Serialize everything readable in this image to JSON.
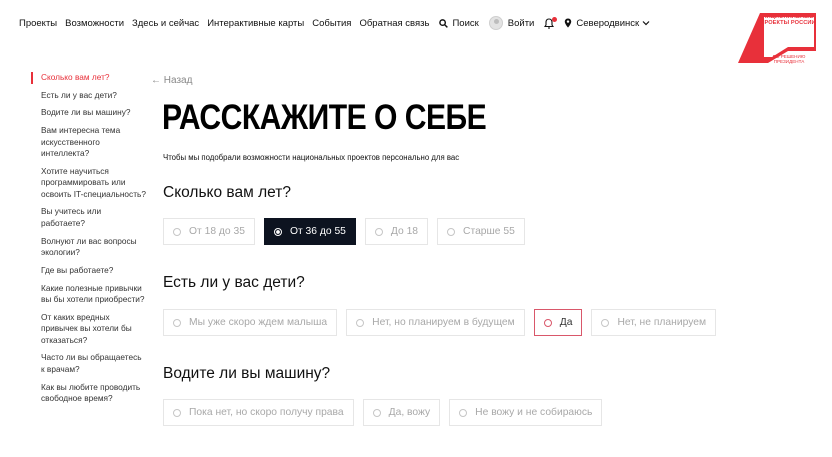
{
  "header": {
    "nav": [
      "Проекты",
      "Возможности",
      "Здесь и сейчас",
      "Интерактивные карты",
      "События",
      "Обратная связь"
    ],
    "search_label": "Поиск",
    "login_label": "Войти",
    "city": "Северодвинск",
    "logo_text": "НАЦИОНАЛЬНЫЕ ПРОЕКТЫ РОССИИ",
    "logo_subtext": "ПО РЕШЕНИЮ ПРЕЗИДЕНТА",
    "colors": {
      "brand": "#e8303a",
      "selected": "#0d1320"
    }
  },
  "sidebar": {
    "items": [
      "Сколько вам лет?",
      "Есть ли у вас дети?",
      "Водите ли вы машину?",
      "Вам интересна тема искусственного интеллекта?",
      "Хотите научиться программировать или освоить IT-специальность?",
      "Вы учитесь или работаете?",
      "Волнуют ли вас вопросы экологии?",
      "Где вы работаете?",
      "Какие полезные привычки вы бы хотели приобрести?",
      "От каких вредных привычек вы хотели бы отказаться?",
      "Часто ли вы обращаетесь к врачам?",
      "Как вы любите проводить свободное время?"
    ],
    "active_index": 0
  },
  "main": {
    "back_label": "← Назад",
    "title": "РАССКАЖИТЕ О СЕБЕ",
    "subtitle": "Чтобы мы подобрали возможности национальных проектов персонально для вас",
    "questions": [
      {
        "question": "Сколько вам лет?",
        "options": [
          "От 18 до 35",
          "От 36 до 55",
          "До 18",
          "Старше 55"
        ],
        "selected": "От 36 до 55"
      },
      {
        "question": "Есть ли у вас дети?",
        "options": [
          "Мы уже скоро ждем малыша",
          "Нет, но планируем в будущем",
          "Да",
          "Нет, не планируем"
        ],
        "highlighted": "Да"
      },
      {
        "question": "Водите ли вы машину?",
        "options": [
          "Пока нет, но скоро получу права",
          "Да, вожу",
          "Не вожу и не собираюсь"
        ]
      }
    ]
  }
}
